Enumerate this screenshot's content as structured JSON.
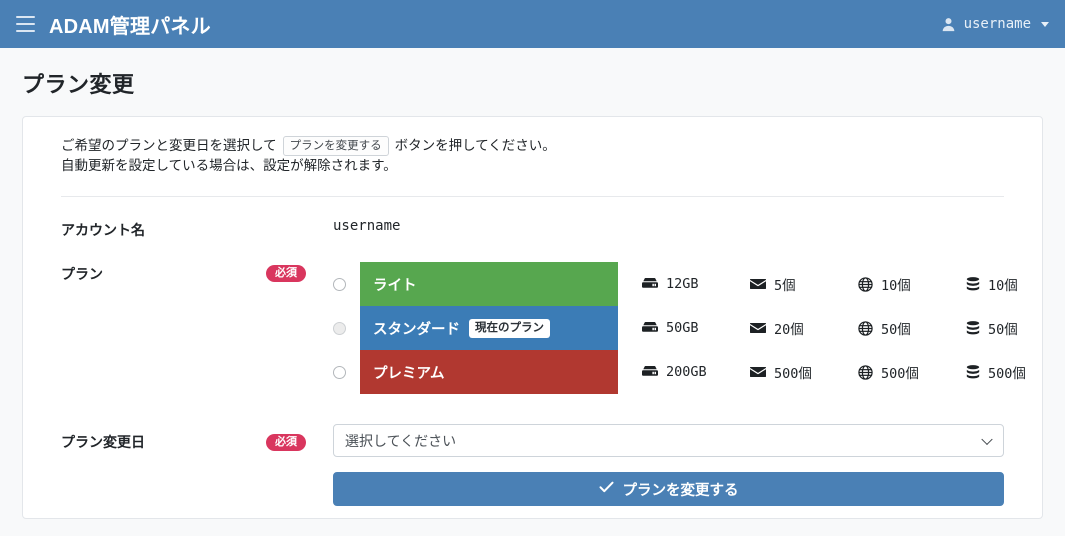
{
  "navbar": {
    "menu_icon": "hamburger-icon",
    "brand": "ADAM管理パネル",
    "user_icon": "user-icon",
    "username": "username",
    "caret_icon": "caret-down-icon"
  },
  "page": {
    "title": "プラン変更"
  },
  "intro": {
    "line1_prefix": "ご希望のプランと変更日を選択して",
    "line1_button": "プランを変更する",
    "line1_suffix": "ボタンを押してください。",
    "line2": "自動更新を設定している場合は、設定が解除されます。"
  },
  "form": {
    "account_label": "アカウント名",
    "account_value": "username",
    "plan_label": "プラン",
    "plan_required": "必須",
    "date_label": "プラン変更日",
    "date_required": "必須",
    "date_placeholder": "選択してください",
    "select_chevron_icon": "chevron-down-icon",
    "submit_label": "プランを変更する",
    "submit_icon": "check-icon"
  },
  "plans": [
    {
      "name": "ライト",
      "color": "#57a74f",
      "selected": false,
      "disabled": false,
      "current": false,
      "badge": "",
      "storage": "12GB",
      "mail": "5個",
      "domain": "10個",
      "database": "10個"
    },
    {
      "name": "スタンダード",
      "color": "#3b7cb6",
      "selected": false,
      "disabled": true,
      "current": true,
      "badge": "現在のプラン",
      "storage": "50GB",
      "mail": "20個",
      "domain": "50個",
      "database": "50個"
    },
    {
      "name": "プレミアム",
      "color": "#b13830",
      "selected": false,
      "disabled": false,
      "current": false,
      "badge": "",
      "storage": "200GB",
      "mail": "500個",
      "domain": "500個",
      "database": "500個"
    }
  ],
  "icons": {
    "storage": "hdd-icon",
    "mail": "envelope-icon",
    "domain": "globe-icon",
    "database": "database-icon"
  },
  "colors": {
    "navbar": "#4a80b5",
    "required_badge": "#d9365e",
    "submit": "#4a80b5",
    "page_background": "#f8f9fa"
  }
}
